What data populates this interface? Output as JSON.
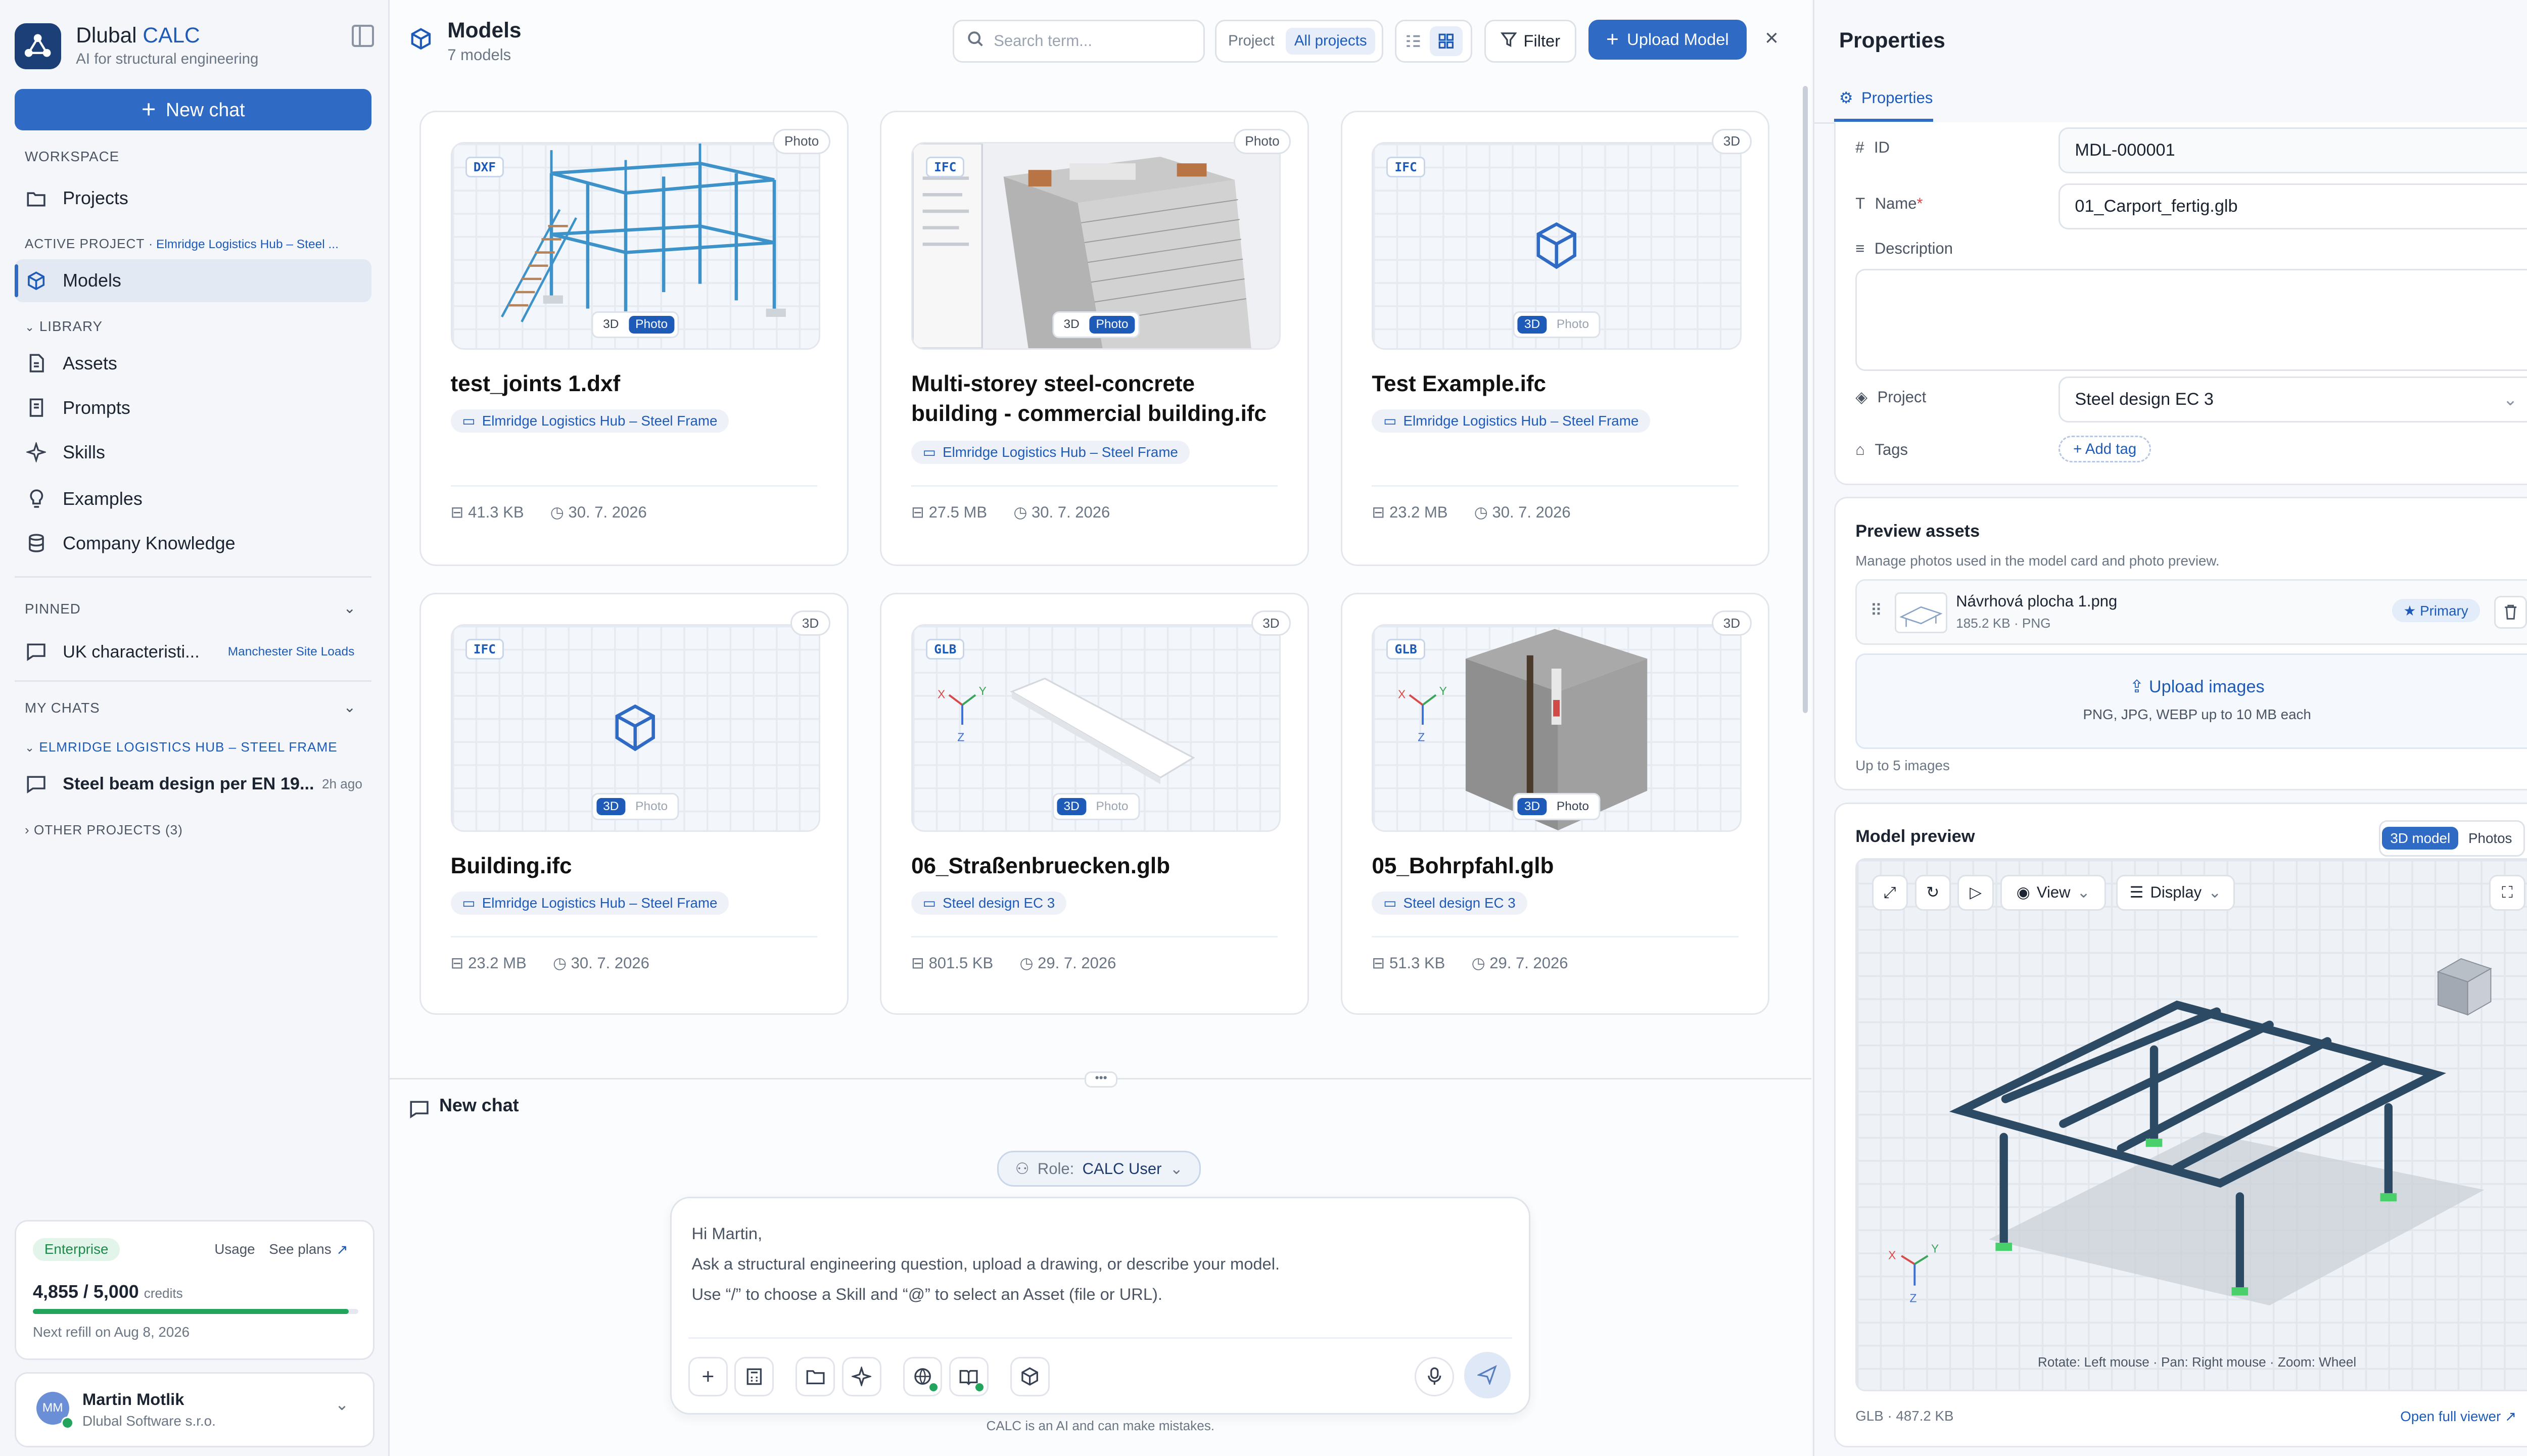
{
  "app": {
    "name_part1": "Dlubal",
    "name_part2": "CALC",
    "tagline": "AI for structural engineering"
  },
  "sidebar": {
    "new_chat": "New chat",
    "workspace_label": "WORKSPACE",
    "projects": "Projects",
    "active_project_label": "ACTIVE PROJECT",
    "active_project_name": "· Elmridge Logistics Hub – Steel ...",
    "models": "Models",
    "library_label": "LIBRARY",
    "library_items": [
      "Assets",
      "Prompts",
      "Skills",
      "Examples",
      "Company Knowledge"
    ],
    "pinned_label": "PINNED",
    "pinned_item": "UK characteristi...",
    "pinned_project": "Manchester Site Loads",
    "my_chats_label": "MY CHATS",
    "chat_group": "ELMRIDGE LOGISTICS HUB – STEEL FRAME",
    "chat_item": "Steel beam design per EN 19...",
    "chat_time": "2h ago",
    "other_projects": "OTHER PROJECTS (3)",
    "plan_badge": "Enterprise",
    "usage": "Usage",
    "see_plans": "See plans",
    "credits_value": "4,855 / 5,000",
    "credits_word": "credits",
    "credits_fraction": 0.971,
    "next_refill": "Next refill on Aug 8, 2026",
    "user_initials": "MM",
    "user_name": "Martin Motlik",
    "user_company": "Dlubal Software s.r.o."
  },
  "models": {
    "title": "Models",
    "count": "7 models",
    "search_placeholder": "Search term...",
    "scope_project": "Project",
    "scope_all": "All projects",
    "filter": "Filter",
    "upload": "Upload Model",
    "cards": [
      {
        "fmt": "DXF",
        "badge": "Photo",
        "toggle_3d": "3D",
        "toggle_photo": "Photo",
        "title1": "test_joints 1.dxf",
        "title2": "",
        "project": "Elmridge Logistics Hub – Steel Frame",
        "size": "41.3 KB",
        "date": "30. 7. 2026"
      },
      {
        "fmt": "IFC",
        "badge": "Photo",
        "toggle_3d": "3D",
        "toggle_photo": "Photo",
        "title1": "Multi-storey steel-concrete",
        "title2": "building - commercial building.ifc",
        "project": "Elmridge Logistics Hub – Steel Frame",
        "size": "27.5 MB",
        "date": "30. 7. 2026"
      },
      {
        "fmt": "IFC",
        "badge": "3D",
        "toggle_3d": "3D",
        "toggle_photo": "Photo",
        "title1": "Test Example.ifc",
        "title2": "",
        "project": "Elmridge Logistics Hub – Steel Frame",
        "size": "23.2 MB",
        "date": "30. 7. 2026"
      },
      {
        "fmt": "IFC",
        "badge": "3D",
        "toggle_3d": "3D",
        "toggle_photo": "Photo",
        "title1": "Building.ifc",
        "title2": "",
        "project": "Elmridge Logistics Hub – Steel Frame",
        "size": "23.2 MB",
        "date": "30. 7. 2026"
      },
      {
        "fmt": "GLB",
        "badge": "3D",
        "toggle_3d": "3D",
        "toggle_photo": "Photo",
        "title1": "06_Straßenbruecken.glb",
        "title2": "",
        "project": "Steel design EC 3",
        "size": "801.5 KB",
        "date": "29. 7. 2026"
      },
      {
        "fmt": "GLB",
        "badge": "3D",
        "toggle_3d": "3D",
        "toggle_photo": "Photo",
        "title1": "05_Bohrpfahl.glb",
        "title2": "",
        "project": "Steel design EC 3",
        "size": "51.3 KB",
        "date": "29. 7. 2026"
      }
    ]
  },
  "chat": {
    "title": "New chat",
    "role_label": "Role:",
    "role_value": "CALC User",
    "greeting": "Hi Martin,",
    "line1": "Ask a structural engineering question, upload a drawing, or describe your model.",
    "line2": "Use “/” to choose a Skill and “@” to select an Asset (file or URL).",
    "disclaimer": "CALC is an AI and can make mistakes."
  },
  "properties": {
    "title": "Properties",
    "tab": "Properties",
    "id_label": "ID",
    "id_value": "MDL-000001",
    "name_label": "Name",
    "name_required": "*",
    "name_value": "01_Carport_fertig.glb",
    "description_label": "Description",
    "project_label": "Project",
    "project_value": "Steel design EC 3",
    "tags_label": "Tags",
    "add_tag": "+ Add tag",
    "preview_title": "Preview assets",
    "preview_desc": "Manage photos used in the model card and photo preview.",
    "asset_name": "Návrhová plocha 1.png",
    "asset_meta": "185.2 KB · PNG",
    "primary": "Primary",
    "upload_images": "Upload images",
    "upload_hint": "PNG, JPG, WEBP up to 10 MB each",
    "limit": "Up to 5 images",
    "model_preview": "Model preview",
    "tab_3d": "3D model",
    "tab_photos": "Photos",
    "view": "View",
    "display": "Display",
    "hint": "Rotate: Left mouse · Pan: Right mouse · Zoom: Wheel",
    "file_meta": "GLB · 487.2 KB",
    "open_full": "Open full viewer"
  },
  "colors": {
    "accent": "#2f6ac5",
    "brand_dark": "#1d3f78",
    "success": "#22a45d"
  }
}
